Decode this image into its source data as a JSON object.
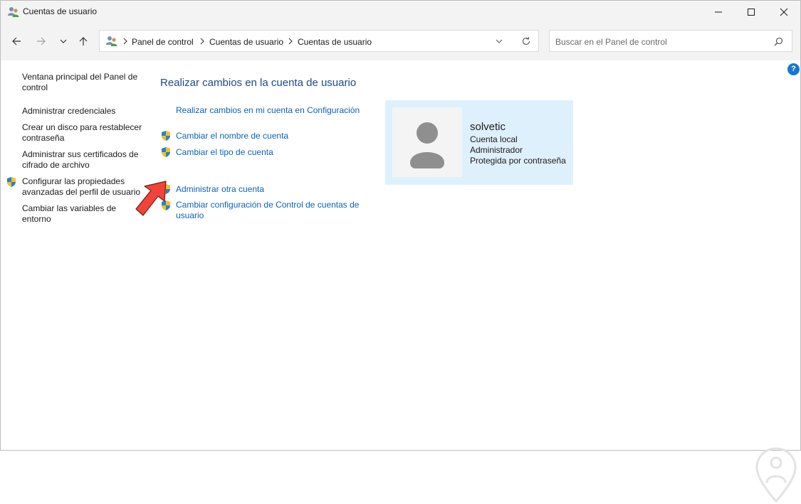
{
  "window": {
    "title": "Cuentas de usuario"
  },
  "nav": {
    "breadcrumbs": [
      "Panel de control",
      "Cuentas de usuario",
      "Cuentas de usuario"
    ],
    "search_placeholder": "Buscar en el Panel de control"
  },
  "help": {
    "label": "?"
  },
  "sidebar": {
    "items": [
      {
        "label": "Ventana principal del Panel de control"
      },
      {
        "label": "Administrar credenciales"
      },
      {
        "label": "Crear un disco para restablecer contraseña"
      },
      {
        "label": "Administrar sus certificados de cifrado de archivo"
      },
      {
        "label": "Configurar las propiedades avanzadas del perfil de usuario"
      },
      {
        "label": "Cambiar las variables de entorno"
      }
    ]
  },
  "main": {
    "heading": "Realizar cambios en la cuenta de usuario",
    "tasks": [
      {
        "label": "Realizar cambios en mi cuenta en Configuración"
      },
      {
        "label": "Cambiar el nombre de cuenta"
      },
      {
        "label": "Cambiar el tipo de cuenta"
      },
      {
        "label": "Administrar otra cuenta"
      },
      {
        "label": "Cambiar configuración de Control de cuentas de usuario"
      }
    ]
  },
  "user": {
    "name": "solvetic",
    "details": [
      "Cuenta local",
      "Administrador",
      "Protegida por contraseña"
    ]
  },
  "colors": {
    "link": "#0b63b6",
    "heading": "#1a4a8c",
    "card_bg": "#dff0fd",
    "annotation_arrow": "#f0443a"
  }
}
